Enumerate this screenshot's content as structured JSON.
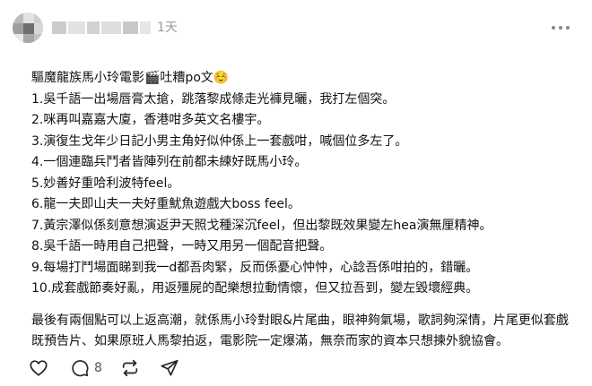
{
  "post": {
    "author": {
      "avatar_icon": "pixelated-avatar-icon",
      "name_censored": true
    },
    "time": "1天",
    "more_icon": "more-horizontal-icon",
    "lines": [
      "驅魔龍族馬小玲電影🎬吐糟po文☺️",
      "1.吳千語一出場唇膏太搶，跳落黎成條走光褲見曬，我打左個突。",
      "2.咪再叫嘉嘉大廈，香港咁多英文名樓宇。",
      "3.演復生戈年少日記小男主角好似仲係上一套戲咁，喊個位多左了。",
      "4.一個連臨兵鬥者皆陣列在前都未練好既馬小玲。",
      "5.妙善好重哈利波特feel。",
      "6.龍一夫即山夫一夫好重魷魚遊戲大boss feel。",
      "7.黃宗澤似係刻意想演返尹天照戈種深沉feel，但出黎既效果變左hea演無厘精神。",
      "8.吳千語一時用自己把聲，一時又用另一個配音把聲。",
      "9.每場打鬥場面睇到我一d都吾肉緊，反而係憂心忡忡，心諗吾係咁拍的，錯曬。",
      "10.成套戲節奏好亂，用返殭屍的配樂想拉動情懷，但又拉吾到，變左毀壞經典。"
    ],
    "closing": "最後有兩個點可以上返高潮，就係馬小玲對眼&片尾曲，眼神夠氣場，歌詞夠深情，片尾更似套戲既預告片、如果原班人馬黎拍返，電影院一定爆滿，無奈而家的資本只想揀外貌協會。"
  },
  "actions": {
    "like_icon": "heart-icon",
    "comment_icon": "comment-icon",
    "comment_count": "8",
    "repost_icon": "repost-icon",
    "share_icon": "send-icon"
  },
  "colors": {
    "text": "#111111",
    "muted": "#9a9a9a",
    "icon": "#222222"
  }
}
